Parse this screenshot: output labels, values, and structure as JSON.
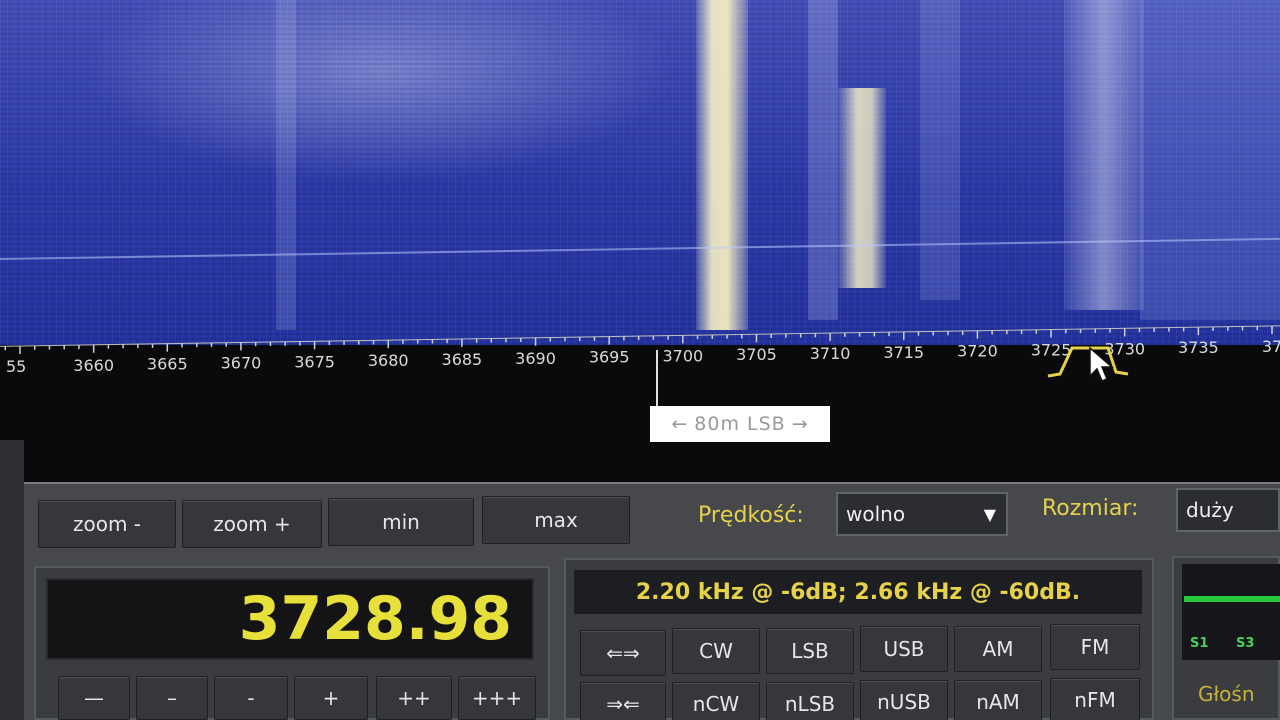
{
  "scale": {
    "labels": [
      "55",
      "3660",
      "3665",
      "3670",
      "3675",
      "3680",
      "3685",
      "3690",
      "3695",
      "3700",
      "3705",
      "3710",
      "3715",
      "3720",
      "3725",
      "3730",
      "3735",
      "37"
    ]
  },
  "band_marker": {
    "left_arrow": "←",
    "text": "80m LSB",
    "right_arrow": "→"
  },
  "toolbar": {
    "zoom_out": "zoom -",
    "zoom_in": "zoom +",
    "min": "min",
    "max": "max",
    "speed_label": "Prędkość:",
    "speed_value": "wolno",
    "size_label": "Rozmiar:",
    "size_value": "duży"
  },
  "frequency": {
    "value": "3728.98",
    "step_buttons": [
      "—",
      "–",
      "-",
      "+",
      "++",
      "+++"
    ]
  },
  "bandwidth": {
    "text": "2.20 kHz @ -6dB; 2.66 kHz @ -60dB."
  },
  "modes": {
    "row1": [
      "⇐⇒",
      "CW",
      "LSB",
      "USB",
      "AM",
      "FM"
    ],
    "row2": [
      "⇒⇐",
      "nCW",
      "nLSB",
      "nUSB",
      "nAM",
      "nFM"
    ]
  },
  "smeter": {
    "labels": [
      "S1",
      "S3"
    ],
    "volume_label": "Głośn"
  },
  "colors": {
    "accent_yellow": "#e6d24a",
    "frequency_digits": "#e8e03a",
    "waterfall_blue": "#2c3aa8",
    "signal_bar": "#27c93a"
  }
}
